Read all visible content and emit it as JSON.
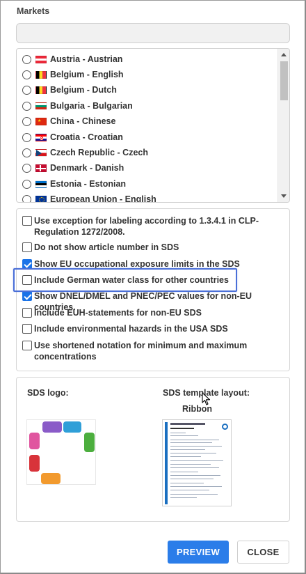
{
  "markets": {
    "label": "Markets",
    "search": {
      "value": "",
      "placeholder": ""
    },
    "items": [
      {
        "label": "Austria - Austrian",
        "flag": "austria-flag"
      },
      {
        "label": "Belgium - English",
        "flag": "belgium-flag"
      },
      {
        "label": "Belgium - Dutch",
        "flag": "belgium-flag"
      },
      {
        "label": "Bulgaria - Bulgarian",
        "flag": "bulgaria-flag"
      },
      {
        "label": "China - Chinese",
        "flag": "china-flag"
      },
      {
        "label": "Croatia - Croatian",
        "flag": "croatia-flag"
      },
      {
        "label": "Czech Republic - Czech",
        "flag": "czech-flag"
      },
      {
        "label": "Denmark - Danish",
        "flag": "denmark-flag"
      },
      {
        "label": "Estonia - Estonian",
        "flag": "estonia-flag"
      },
      {
        "label": "European Union - English",
        "flag": "eu-flag"
      }
    ]
  },
  "options": [
    {
      "label": "Use exception for labeling according to 1.3.4.1 in CLP-Regulation 1272/2008.",
      "checked": false
    },
    {
      "label": "Do not show article number in SDS",
      "checked": false
    },
    {
      "label": "Show EU occupational exposure limits in the SDS",
      "checked": true
    },
    {
      "label": "Include German water class for other countries",
      "checked": false
    },
    {
      "label": "Show DNEL/DMEL and PNEC/PEC values for non-EU countries.",
      "checked": true
    },
    {
      "label": "Include EUH-statements for non-EU SDS",
      "checked": false
    },
    {
      "label": "Include environmental hazards in the USA SDS",
      "checked": false
    },
    {
      "label": "Use shortened notation for minimum and maximum concentrations",
      "checked": false
    }
  ],
  "sds": {
    "logo_title": "SDS logo:",
    "template_title": "SDS template layout:",
    "template_name": "Ribbon"
  },
  "buttons": {
    "preview": "PREVIEW",
    "close": "CLOSE"
  },
  "colors": {
    "accent": "#2b7de9",
    "checkbox_checked": "#1a73e8",
    "highlight_border": "#4a6fd8"
  }
}
